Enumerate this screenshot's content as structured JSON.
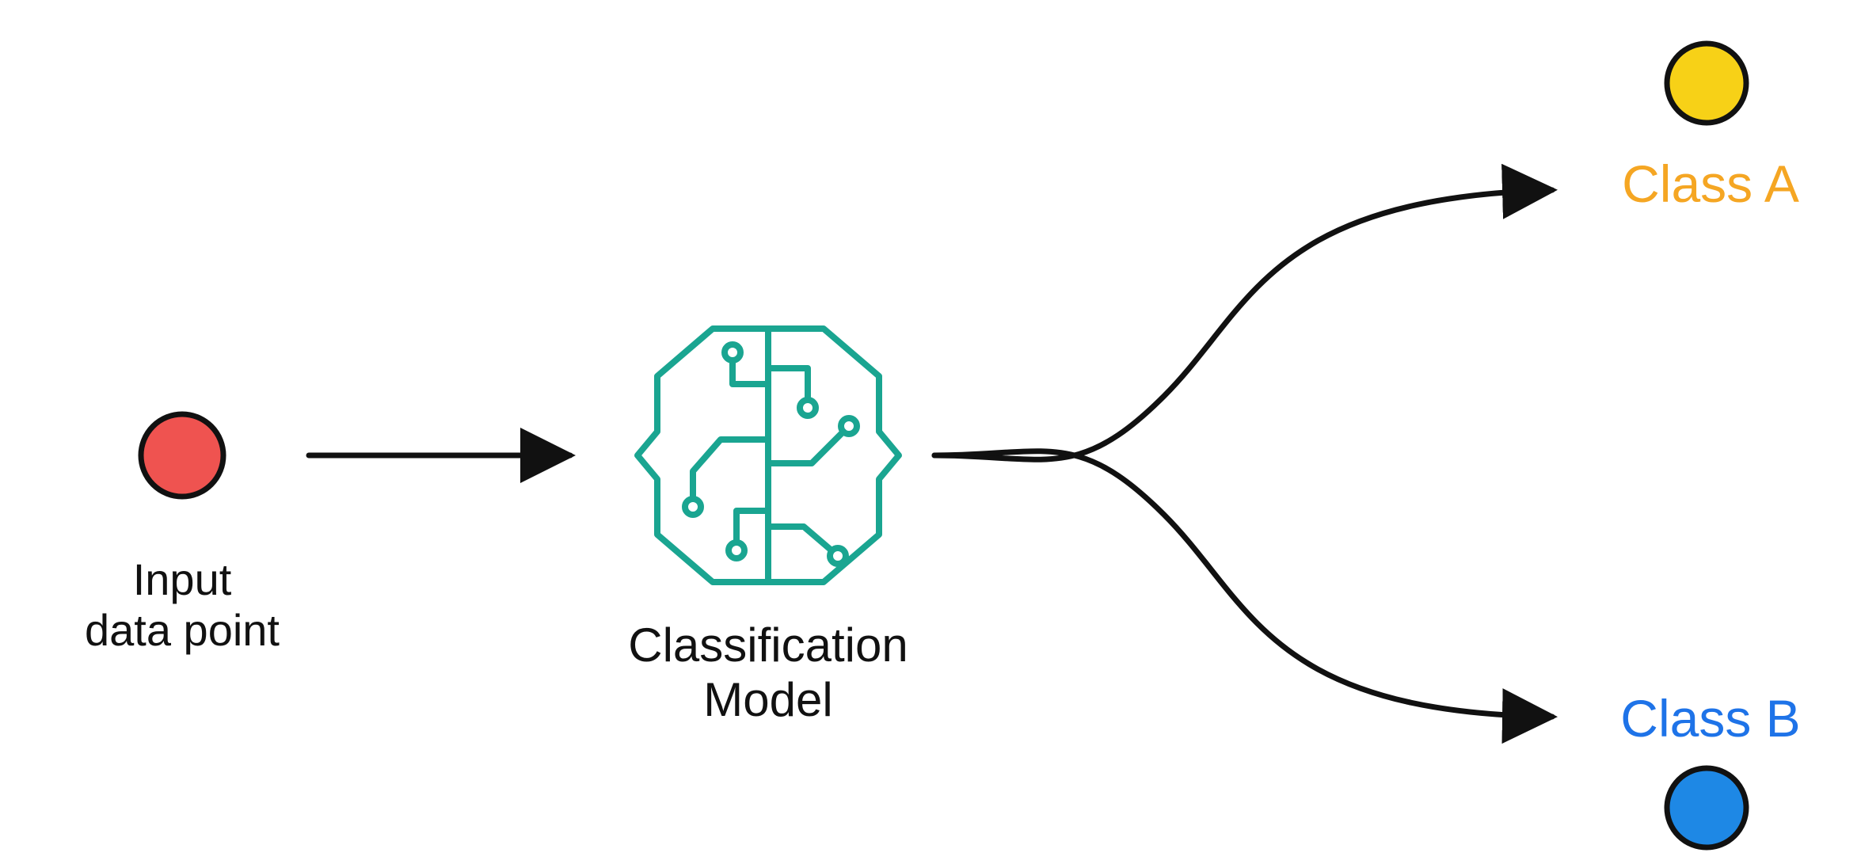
{
  "diagram": {
    "input": {
      "label_line1": "Input",
      "label_line2": "data point",
      "color": "#ef5350",
      "stroke": "#111111"
    },
    "model": {
      "label_line1": "Classification",
      "label_line2": "Model",
      "color": "#1aa591"
    },
    "output_a": {
      "label": "Class A",
      "text_color": "#f5a623",
      "dot_fill": "#f7d117",
      "dot_stroke": "#111111"
    },
    "output_b": {
      "label": "Class B",
      "text_color": "#1e73e8",
      "dot_fill": "#1e88e5",
      "dot_stroke": "#111111"
    },
    "arrow_color": "#111111"
  }
}
